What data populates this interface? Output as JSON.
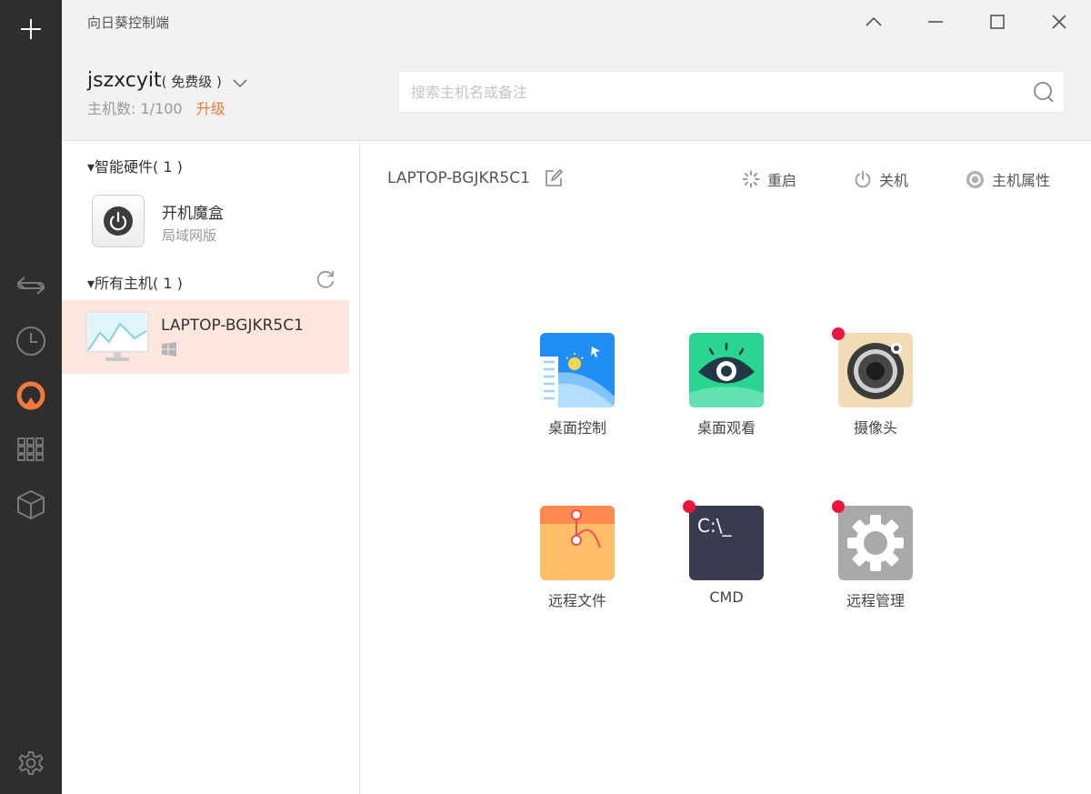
{
  "window": {
    "title": "向日葵控制端"
  },
  "account": {
    "name": "jszxcyit",
    "tier": "( 免费级 )",
    "host_count_label": "主机数:",
    "host_count_value": "1/100",
    "upgrade_label": "升级"
  },
  "search": {
    "placeholder": "搜索主机名或备注"
  },
  "groups": {
    "smart_hardware_label": "▾智能硬件( 1 )",
    "all_hosts_label": "▾所有主机( 1 )"
  },
  "hardware": {
    "name": "开机魔盒",
    "subtitle": "局域网版"
  },
  "host": {
    "name": "LAPTOP-BGJKR5C1",
    "os_icon": "windows-icon"
  },
  "main": {
    "host_name": "LAPTOP-BGJKR5C1",
    "actions": {
      "restart": "重启",
      "shutdown": "关机",
      "properties": "主机属性"
    }
  },
  "tiles": {
    "desktop_control": "桌面控制",
    "desktop_view": "桌面观看",
    "camera": "摄像头",
    "remote_files": "远程文件",
    "cmd": "CMD",
    "cmd_prompt_text": "C:\\_",
    "remote_manage": "远程管理"
  },
  "colors": {
    "accent": "#f07a3a",
    "rail_bg": "#2e2e2e",
    "selected_row": "#fde6dd",
    "badge_red": "#f0143c"
  }
}
